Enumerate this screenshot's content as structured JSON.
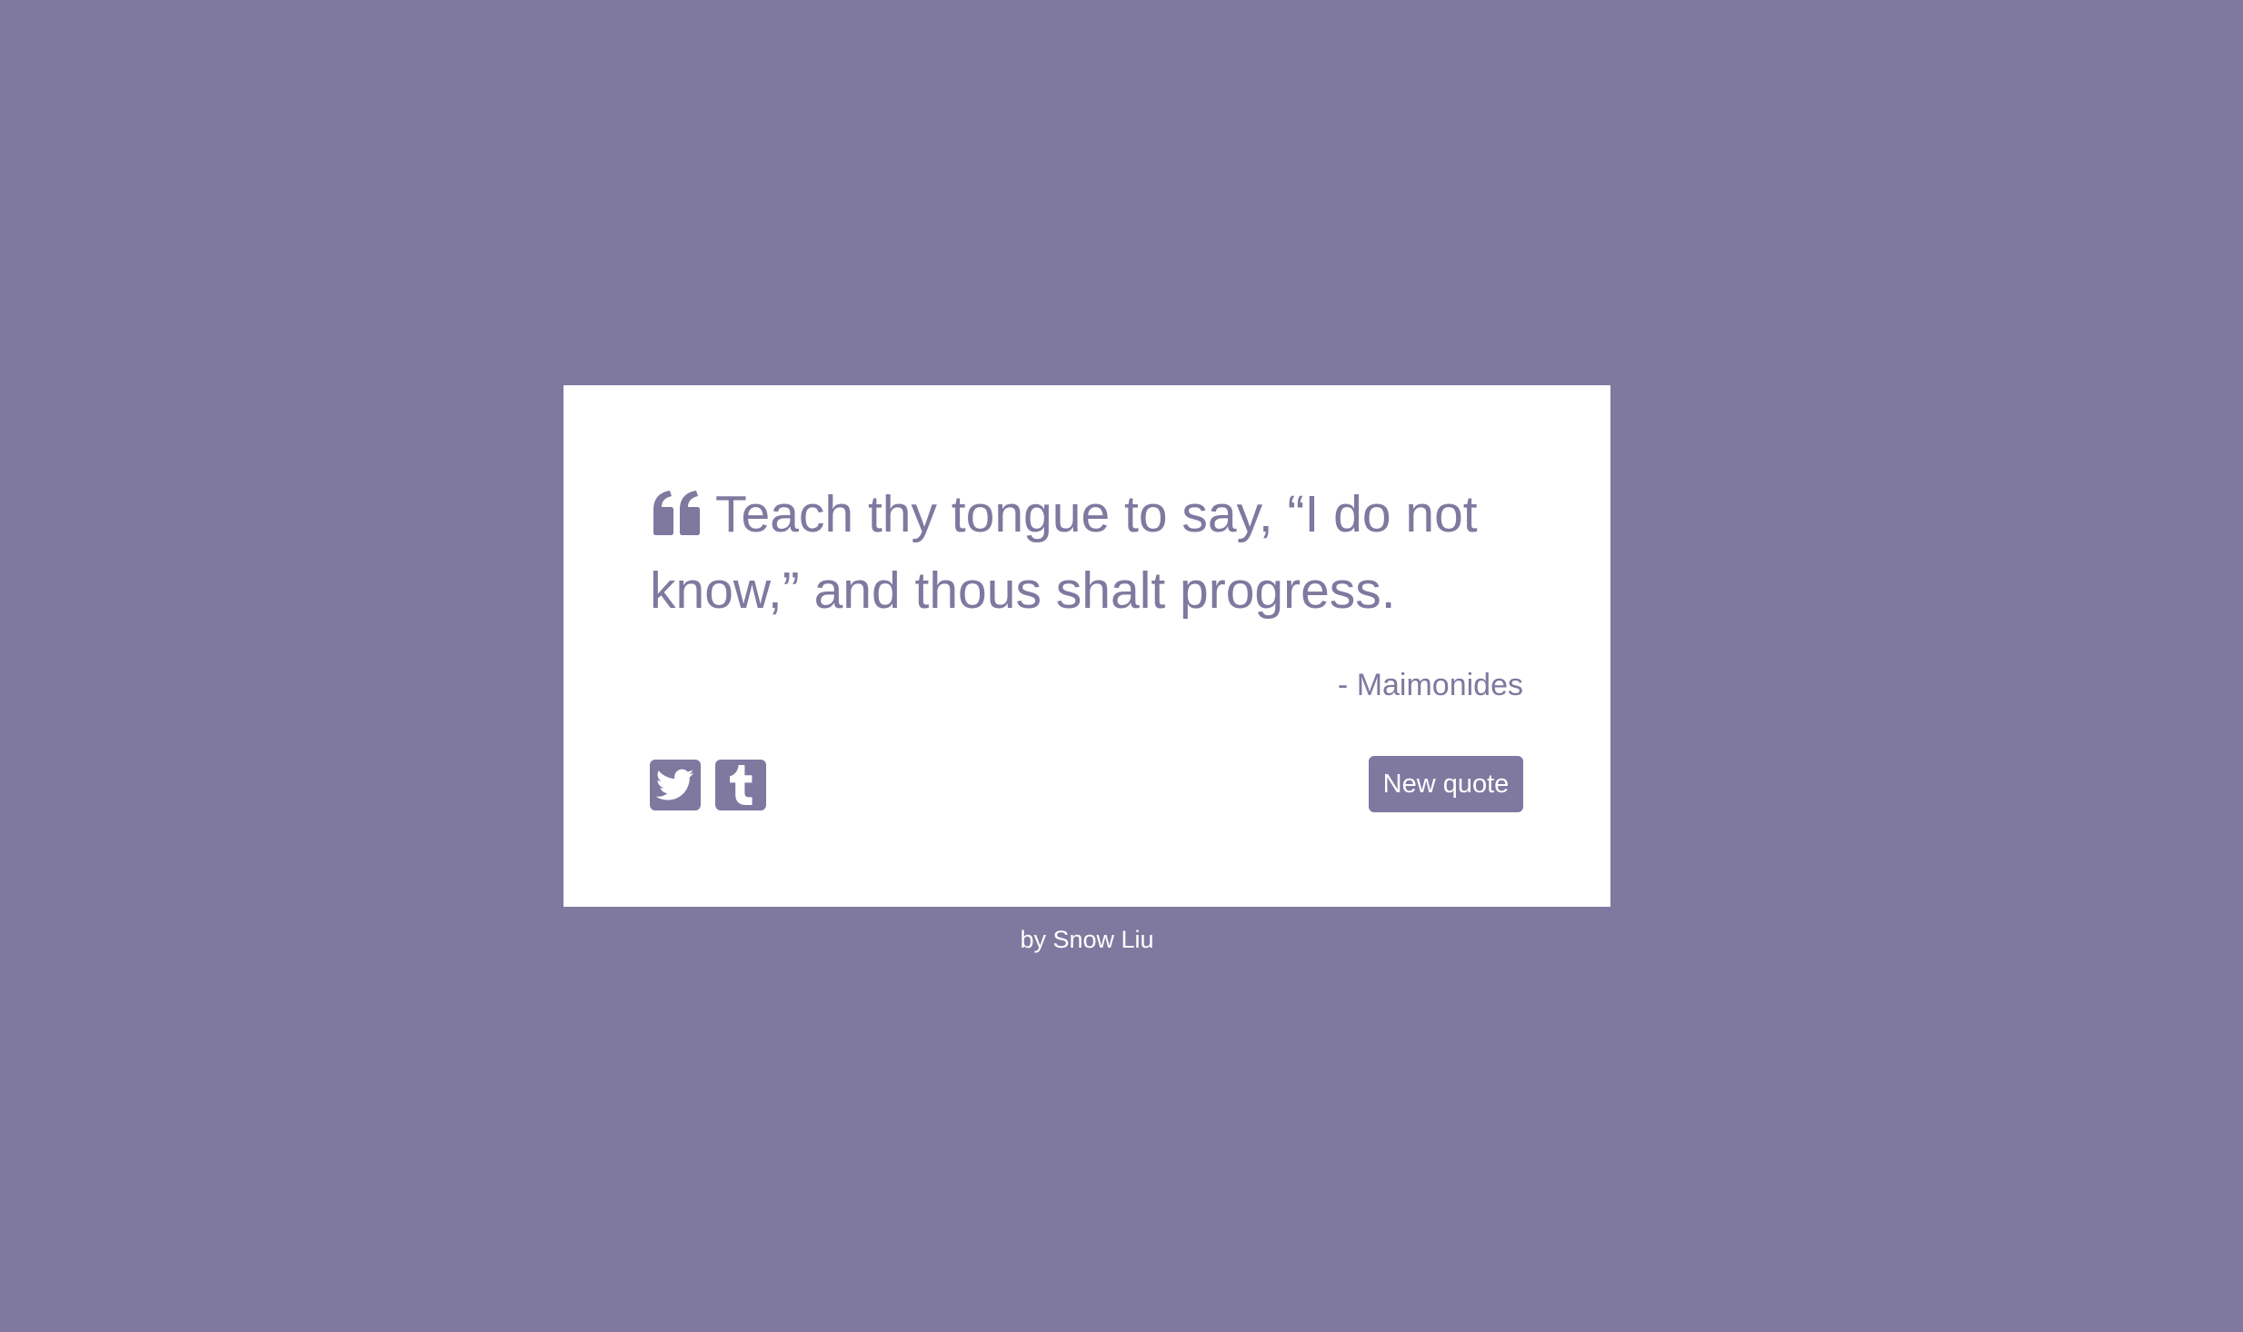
{
  "theme": {
    "background_color": "#7f789f",
    "card_color": "#ffffff",
    "accent_color": "#7f789f",
    "text_on_accent": "#ffffff"
  },
  "quote": {
    "icon": "quote-left-icon",
    "text": "Teach thy tongue to say, “I do not know,” and thous shalt progress.",
    "author": "- Maimonides"
  },
  "actions": {
    "tweet_icon": "twitter-icon",
    "tumblr_icon": "tumblr-icon",
    "new_quote_label": "New quote"
  },
  "footer": {
    "credit": "by Snow Liu"
  }
}
